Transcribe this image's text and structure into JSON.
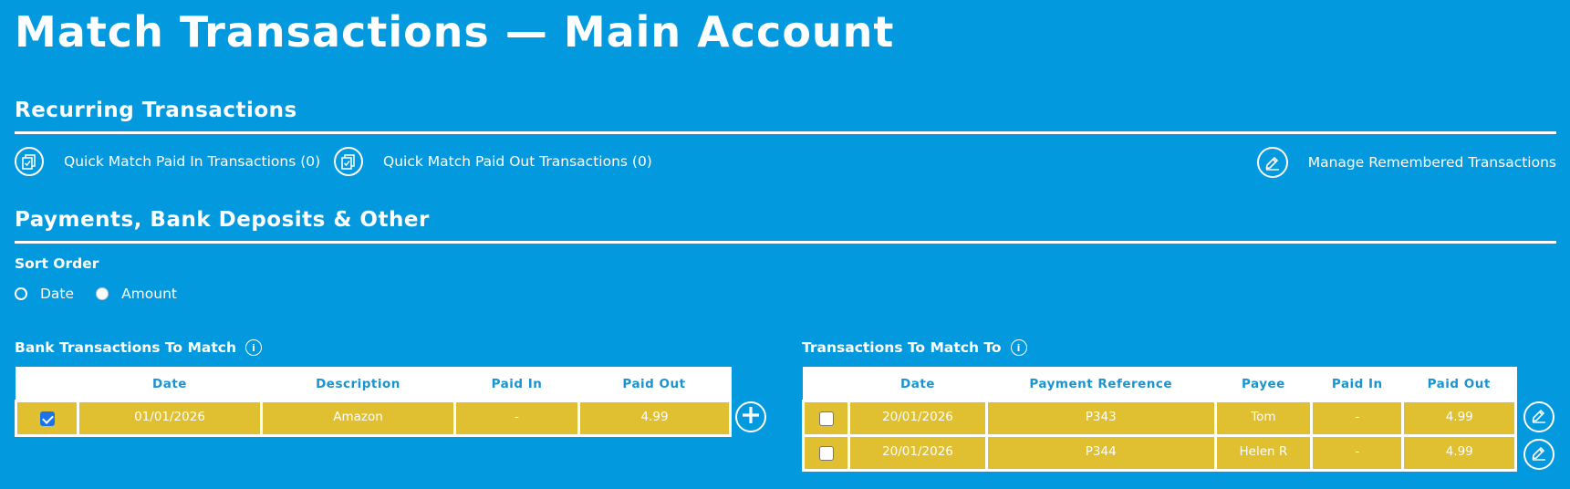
{
  "page": {
    "title": "Match Transactions — Main Account"
  },
  "recurring": {
    "title": "Recurring Transactions",
    "quick_in": {
      "label": "Quick Match Paid In Transactions (0)",
      "icon": "clipboard-check-icon"
    },
    "quick_out": {
      "label": "Quick Match Paid Out Transactions (0)",
      "icon": "clipboard-check-icon"
    },
    "manage": {
      "label": "Manage Remembered Transactions",
      "icon": "pencil-icon"
    }
  },
  "payments": {
    "title": "Payments, Bank Deposits & Other",
    "sort": {
      "label": "Sort Order",
      "options": [
        {
          "label": "Date",
          "selected": true
        },
        {
          "label": "Amount",
          "selected": false
        }
      ]
    }
  },
  "bank_table": {
    "title": "Bank Transactions To Match",
    "columns": [
      "",
      "Date",
      "Description",
      "Paid In",
      "Paid Out"
    ],
    "rows": [
      {
        "checked": true,
        "date": "01/01/2026",
        "description": "Amazon",
        "paid_in": "-",
        "paid_out": "4.99"
      }
    ]
  },
  "match_table": {
    "title": "Transactions To Match To",
    "columns": [
      "",
      "Date",
      "Payment Reference",
      "Payee",
      "Paid In",
      "Paid Out"
    ],
    "rows": [
      {
        "checked": false,
        "date": "20/01/2026",
        "reference": "P343",
        "payee": "Tom",
        "paid_in": "-",
        "paid_out": "4.99"
      },
      {
        "checked": false,
        "date": "20/01/2026",
        "reference": "P344",
        "payee": "Helen R",
        "paid_in": "-",
        "paid_out": "4.99"
      }
    ]
  },
  "colors": {
    "background": "#0299df",
    "row": "#e0bf31",
    "header_text": "#1b93cf",
    "checkbox": "#1a73e8"
  }
}
